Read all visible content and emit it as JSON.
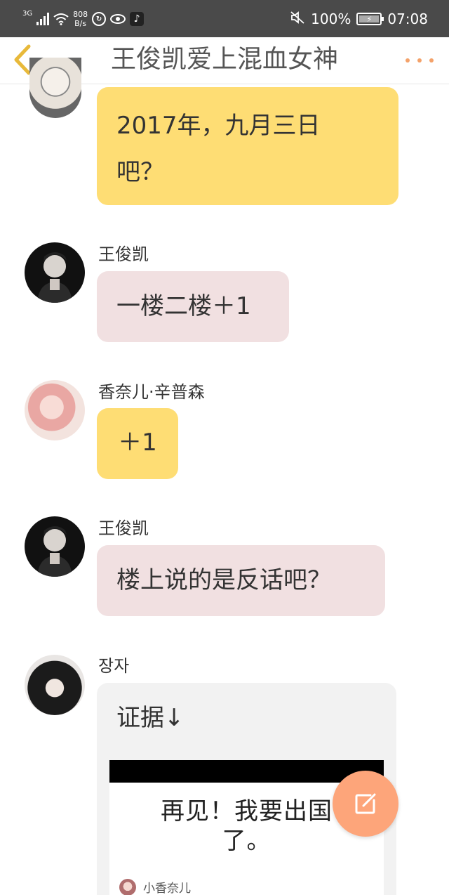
{
  "status_bar": {
    "network": "3G",
    "network_speed_value": "808",
    "network_speed_unit": "B/s",
    "battery": "100%",
    "time": "07:08"
  },
  "nav": {
    "title": "王俊凯爱上混血女神",
    "accent_color": "#e8b93a",
    "more_color": "#f4a26a"
  },
  "messages": [
    {
      "sender": "",
      "text_lines": [
        "2017年，九月三日",
        "吧？"
      ],
      "bubble_color": "#fedd74"
    },
    {
      "sender": "王俊凯",
      "text": "一楼二楼＋1",
      "bubble_color": "#f1e0e1"
    },
    {
      "sender": "香奈儿·辛普森",
      "text": "＋1",
      "bubble_color": "#fedd74"
    },
    {
      "sender": "王俊凯",
      "text": "楼上说的是反话吧？",
      "bubble_color": "#f1e0e1"
    },
    {
      "sender": "장자",
      "text": "证据↓",
      "bubble_color": "#f2f2f2",
      "attachment": {
        "text_lines": [
          "再见！我要出国",
          "了。"
        ],
        "username": "小香奈儿"
      }
    }
  ],
  "fab": {
    "icon": "edit-icon",
    "color": "#fda57a"
  }
}
